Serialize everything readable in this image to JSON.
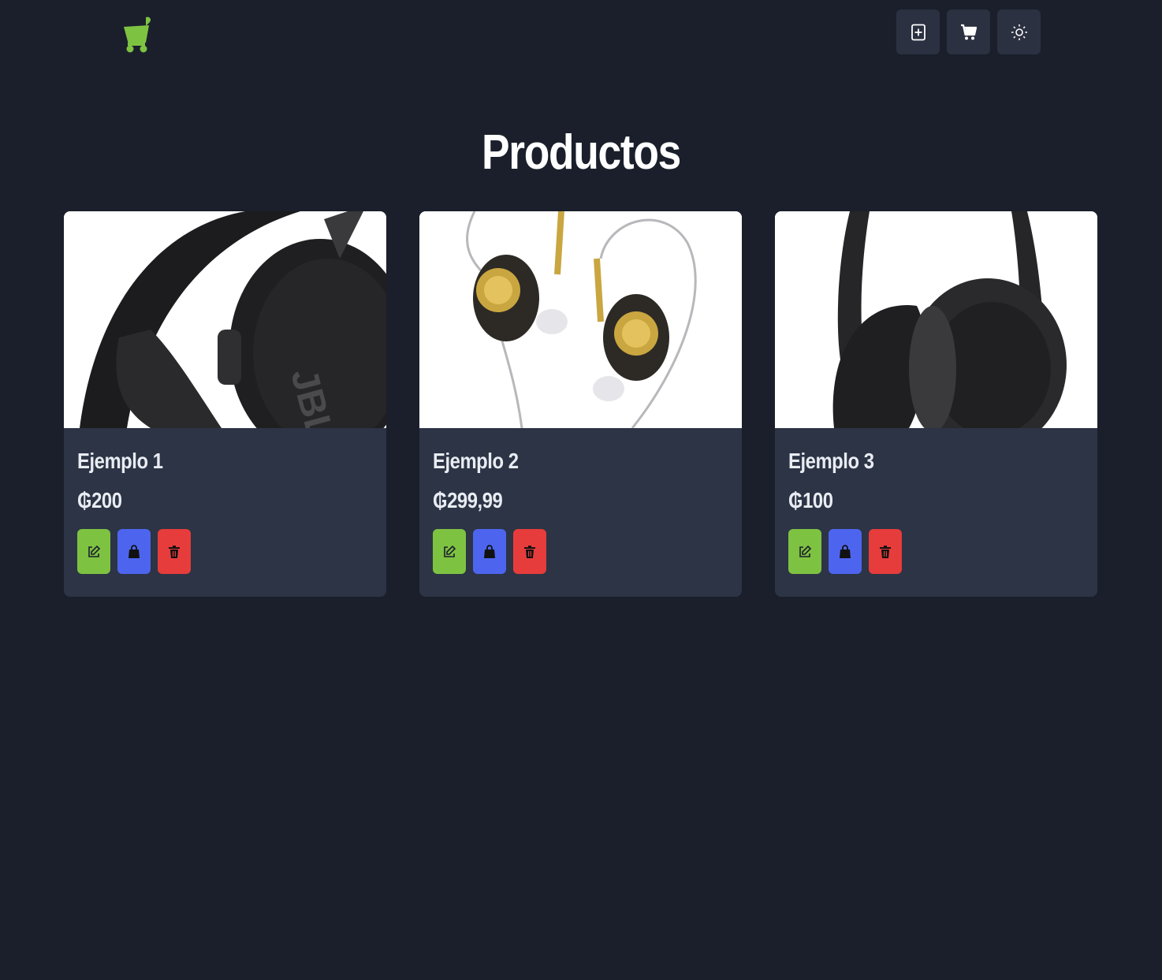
{
  "header": {
    "logo_icon": "shopping-cart-logo",
    "logo_color": "#7ec242",
    "actions": [
      {
        "name": "add-product-button",
        "icon": "plus-square-icon"
      },
      {
        "name": "cart-button",
        "icon": "cart-icon"
      },
      {
        "name": "theme-toggle-button",
        "icon": "sun-icon"
      }
    ]
  },
  "main": {
    "title": "Productos",
    "products": [
      {
        "name": "Ejemplo 1",
        "price": "₲200",
        "image": "over-ear-headphones-jbl"
      },
      {
        "name": "Ejemplo 2",
        "price": "₲299,99",
        "image": "in-ear-monitors"
      },
      {
        "name": "Ejemplo 3",
        "price": "₲100",
        "image": "over-ear-headphones-black"
      }
    ],
    "card_actions": [
      {
        "name": "edit",
        "icon": "edit-icon",
        "color": "#7ec242"
      },
      {
        "name": "buy",
        "icon": "shopping-bag-icon",
        "color": "#4d65ee"
      },
      {
        "name": "delete",
        "icon": "trash-icon",
        "color": "#e73c3c"
      }
    ]
  },
  "colors": {
    "background": "#1a1f2b",
    "card": "#2c3445",
    "header_button": "#2b3140"
  }
}
